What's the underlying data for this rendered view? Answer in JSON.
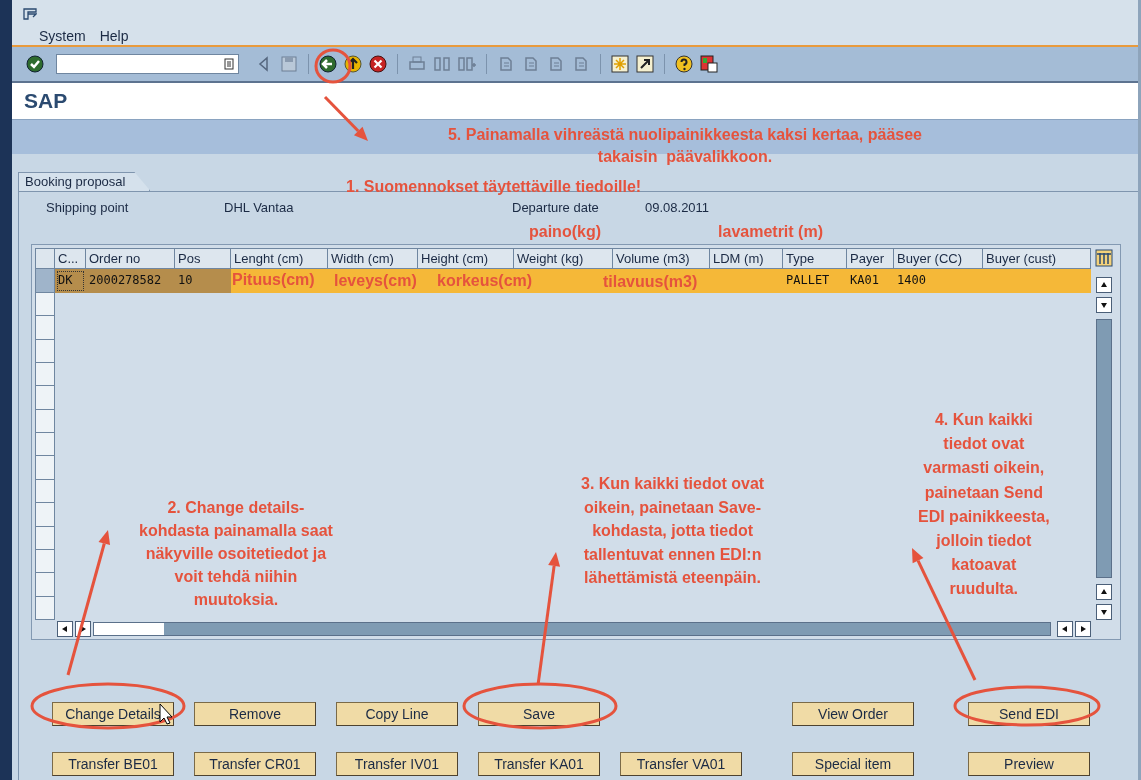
{
  "menu": [
    {
      "label": "System"
    },
    {
      "label": "Help"
    }
  ],
  "title": "SAP",
  "panel": {
    "tab": "Booking proposal",
    "fields": [
      {
        "label": "Shipping point",
        "value": "DHL Vantaa"
      },
      {
        "label": "Departure date",
        "value": "09.08.2011"
      }
    ]
  },
  "table": {
    "columns": [
      "C...",
      "Order no",
      "Pos",
      "Lenght (cm)",
      "Width (cm)",
      "Height (cm)",
      "Weight (kg)",
      "Volume (m3)",
      "LDM (m)",
      "Type",
      "Payer",
      "Buyer (CC)",
      "Buyer (cust)"
    ],
    "rows": [
      {
        "selected": true,
        "cells": [
          "DK",
          "2000278582",
          "10",
          null,
          null,
          null,
          null,
          null,
          null,
          "PALLET",
          "KA01",
          "1400",
          null
        ]
      }
    ]
  },
  "buttons": [
    {
      "left": [
        "Change Details",
        "Remove",
        "Copy Line",
        "Save"
      ],
      "right": [
        "View Order",
        "Send EDI"
      ]
    },
    {
      "left": [
        "Transfer BE01",
        "Transfer CR01",
        "Transfer IV01",
        "Transfer KA01",
        "Transfer VA01"
      ],
      "right": [
        "Special item",
        "Preview"
      ]
    }
  ],
  "annotations": [
    {
      "text": "5. Painamalla vihreästä nuolipainikkeesta kaksi kertaa, pääsee\ntakaisin  päävalikkoon."
    },
    {
      "text": "1. Suomennokset täytettäville tiedoille!"
    },
    {
      "text": "paino(kg)"
    },
    {
      "text": "lavametrit (m)"
    },
    {
      "text": "Pituus(cm)",
      "kind": "row"
    },
    {
      "text": "leveys(cm)",
      "kind": "row"
    },
    {
      "text": "korkeus(cm)",
      "kind": "row"
    },
    {
      "text": "tilavuus(m3)",
      "kind": "row"
    },
    {
      "text": "2. Change details-\nkohdasta painamalla saat\nnäkyville osoitetiedot ja\nvoit tehdä niihin\nmuutoksia."
    },
    {
      "text": "3. Kun kaikki tiedot ovat\noikein, painetaan Save-\nkohdasta, jotta tiedot\ntallentuvat ennen EDI:n\nlähettämistä eteenpäin."
    },
    {
      "text": "4. Kun kaikki\ntiedot ovat\nvarmasti oikein,\npainetaan Send\nEDI painikkeesta,\njolloin tiedot\nkatoavat\nruudulta."
    }
  ]
}
